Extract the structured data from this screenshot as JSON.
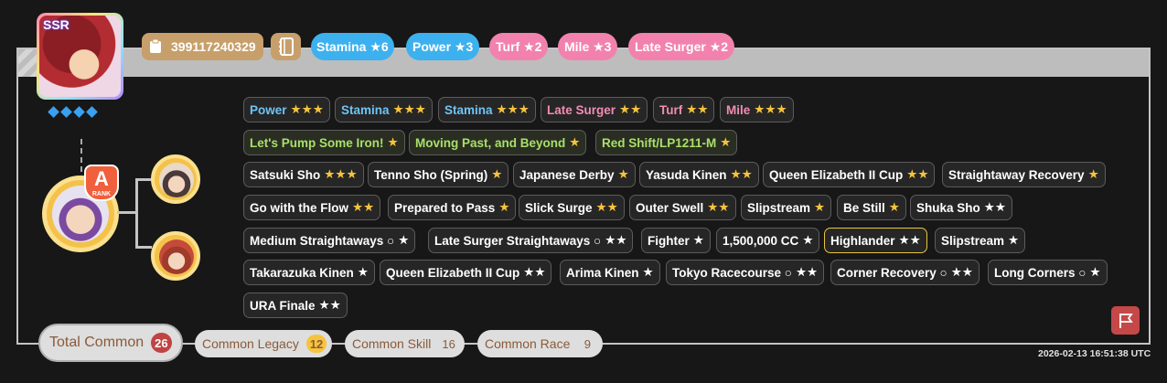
{
  "header": {
    "rarity_label": "SSR",
    "trainer_id": "399117240329",
    "top_sparks": [
      {
        "label": "Stamina",
        "stars": "★6",
        "kind": "blue"
      },
      {
        "label": "Power",
        "stars": "★3",
        "kind": "blue"
      },
      {
        "label": "Turf",
        "stars": "★2",
        "kind": "pink"
      },
      {
        "label": "Mile",
        "stars": "★3",
        "kind": "pink"
      },
      {
        "label": "Late Surger",
        "stars": "★2",
        "kind": "pink"
      }
    ]
  },
  "rank": {
    "letter": "A",
    "caption": "RANK"
  },
  "rows": [
    [
      {
        "label": "Power",
        "stars": "★★★",
        "kind": "b"
      },
      {
        "label": "Stamina",
        "stars": "★★★",
        "kind": "b"
      },
      {
        "label": "Stamina",
        "stars": "★★★",
        "kind": "b"
      },
      {
        "label": "Late Surger",
        "stars": "★★",
        "kind": "p"
      },
      {
        "label": "Turf",
        "stars": "★★",
        "kind": "p"
      },
      {
        "label": "Mile",
        "stars": "★★★",
        "kind": "p"
      }
    ],
    [
      {
        "label": "Let's Pump Some Iron!",
        "stars": "★",
        "kind": "g"
      },
      {
        "label": "Moving Past, and Beyond",
        "stars": "★",
        "kind": "g"
      },
      {
        "label": "Red Shift/LP1211-M",
        "stars": "★",
        "kind": "g"
      }
    ],
    [
      {
        "label": "Satsuki Sho",
        "stars": "★★★",
        "kind": "w"
      },
      {
        "label": "Tenno Sho (Spring)",
        "stars": "★",
        "kind": "w"
      },
      {
        "label": "Japanese Derby",
        "stars": "★",
        "kind": "w"
      },
      {
        "label": "Yasuda Kinen",
        "stars": "★★",
        "kind": "w"
      },
      {
        "label": "Queen Elizabeth II Cup",
        "stars": "★★",
        "kind": "w"
      },
      {
        "label": "Straightaway Recovery",
        "stars": "★",
        "kind": "w"
      }
    ],
    [
      {
        "label": "Go with the Flow",
        "stars": "★★",
        "kind": "w"
      },
      {
        "label": "Prepared to Pass",
        "stars": "★",
        "kind": "w"
      },
      {
        "label": "Slick Surge",
        "stars": "★★",
        "kind": "w"
      },
      {
        "label": "Outer Swell",
        "stars": "★★",
        "kind": "w"
      },
      {
        "label": "Slipstream",
        "stars": "★",
        "kind": "w"
      },
      {
        "label": "Be Still",
        "stars": "★",
        "kind": "w"
      },
      {
        "label": "Shuka Sho",
        "stars": "★★",
        "kind": "ww"
      }
    ],
    [
      {
        "label": "Medium Straightaways ○",
        "stars": "★",
        "kind": "ww"
      },
      {
        "label": "Late Surger Straightaways ○",
        "stars": "★★",
        "kind": "ww"
      },
      {
        "label": "Fighter",
        "stars": "★",
        "kind": "ww"
      },
      {
        "label": "1,500,000 CC",
        "stars": "★",
        "kind": "ww"
      },
      {
        "label": "Highlander",
        "stars": "★★",
        "kind": "gold"
      },
      {
        "label": "Slipstream",
        "stars": "★",
        "kind": "ww"
      }
    ],
    [
      {
        "label": "Takarazuka Kinen",
        "stars": "★",
        "kind": "ww"
      },
      {
        "label": "Queen Elizabeth II Cup",
        "stars": "★★",
        "kind": "ww"
      },
      {
        "label": "Arima Kinen",
        "stars": "★",
        "kind": "ww"
      },
      {
        "label": "Tokyo Racecourse ○",
        "stars": "★★",
        "kind": "ww"
      },
      {
        "label": "Corner Recovery ○",
        "stars": "★★",
        "kind": "ww"
      },
      {
        "label": "Long Corners ○",
        "stars": "★",
        "kind": "ww"
      }
    ],
    [
      {
        "label": "URA Finale",
        "stars": "★★",
        "kind": "ww"
      }
    ]
  ],
  "footer": {
    "total": {
      "label": "Total Common",
      "count": "26"
    },
    "legacy": {
      "label": "Common Legacy",
      "count": "12"
    },
    "skill": {
      "label": "Common Skill",
      "count": "16"
    },
    "race": {
      "label": "Common Race",
      "count": "9"
    },
    "timestamp": "2026-02-13 16:51:38 UTC"
  },
  "icons": {
    "book": "book-icon",
    "clipboard": "clipboard-icon",
    "flag": "flag-icon"
  },
  "colors": {
    "blue_spark": "#3db1ef",
    "pink_spark": "#f282ad",
    "gold_star": "#f6c33c",
    "flag_button": "#c44848",
    "total_badge": "#c04343",
    "legacy_badge": "#f6c33c"
  }
}
